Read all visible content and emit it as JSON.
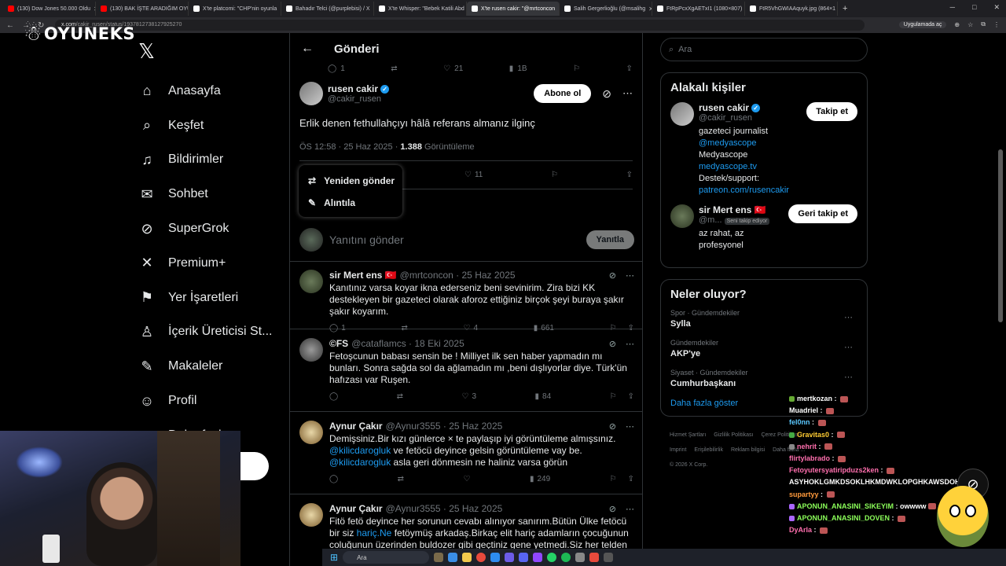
{
  "browser": {
    "tabs": [
      {
        "label": "(130) Dow Jones 50.000 Oldu",
        "color": "#ff0000"
      },
      {
        "label": "(130) BAK İŞTE ARADIĞIM OYUN",
        "color": "#ff0000"
      },
      {
        "label": "X'te platcomi: \"CHP'nin oyunla",
        "color": "#ffffff"
      },
      {
        "label": "Bahadır Telci (@purplebisi) / X",
        "color": "#ffffff"
      },
      {
        "label": "X'te Whisper: \"Bebek Katili Abd",
        "color": "#ffffff"
      },
      {
        "label": "X'te rusen cakir: \"@mrtconcon",
        "color": "#ffffff"
      },
      {
        "label": "Salih Gergerlioğlu (@msalihg",
        "color": "#ffffff"
      },
      {
        "label": "FtRpPcxXgAETxI1 (1080×807)",
        "color": "#ffffff"
      },
      {
        "label": "FtR5VhGWIAAquyk.jpg (864×1",
        "color": "#ffffff"
      }
    ],
    "active_tab": 5,
    "url_host": "x.com",
    "url_path": "/cakir_rusen/status/1937812738127925270",
    "app_button": "Uygulamada aç"
  },
  "overlay": {
    "logo": "OYUNEKS"
  },
  "sidebar": {
    "items": [
      {
        "label": "Anasayfa",
        "icon": "⌂"
      },
      {
        "label": "Keşfet",
        "icon": "⌕"
      },
      {
        "label": "Bildirimler",
        "icon": "♫"
      },
      {
        "label": "Sohbet",
        "icon": "✉"
      },
      {
        "label": "SuperGrok",
        "icon": "⊘"
      },
      {
        "label": "Premium+",
        "icon": "✕"
      },
      {
        "label": "Yer İşaretleri",
        "icon": "⚑"
      },
      {
        "label": "İçerik Üreticisi St...",
        "icon": "♙"
      },
      {
        "label": "Makaleler",
        "icon": "✎"
      },
      {
        "label": "Profil",
        "icon": "☺"
      },
      {
        "label": "Daha fazla",
        "icon": "⋯"
      }
    ]
  },
  "main": {
    "title": "Gönderi",
    "top_actions": {
      "replies": "1",
      "likes": "21",
      "views": "1B"
    },
    "post": {
      "name": "rusen cakir",
      "handle": "@cakir_rusen",
      "subscribe": "Abone ol",
      "text": "Erlik denen fethullahçıyı hâlâ referans almanız ilginç",
      "time": "ÖS 12:58 · 25 Haz 2025 · ",
      "views": "1.388",
      "views_label": " Görüntüleme",
      "likes": "11"
    },
    "popup": {
      "repost": "Yeniden gönder",
      "quote": "Alıntıla"
    },
    "reply_box": {
      "placeholder": "Yanıtını gönder",
      "button": "Yanıtla"
    },
    "replies": [
      {
        "name": "sir Mert ens 🇹🇷",
        "handle": "@mrtconcon · 25 Haz 2025",
        "text": "Kanıtınız varsa koyar ikna ederseniz beni sevinirim. Zira bizi KK destekleyen bir gazeteci olarak aforoz ettiğiniz birçok şeyi buraya şakır şakır koyarım.",
        "replies": "1",
        "likes": "4",
        "views": "661"
      },
      {
        "name": "©FS",
        "handle": "@cataflamcs · 18 Eki 2025",
        "text": "Fetoşcunun babası sensin be ! Milliyet ilk sen haber yapmadın mı bunları. Sonra sağda sol da ağlamadın mı ,beni dışlıyorlar diye. Türk'ün hafızası var Ruşen.",
        "replies": "",
        "likes": "3",
        "views": "84"
      },
      {
        "name": "Aynur Çakır",
        "handle": "@Aynur3555 · 25 Haz 2025",
        "text_pre": "Demişsiniz.Bir kızı günlerce × te paylaşıp iyi görüntüleme almışsınız.",
        "mention1": "@kilicdarogluk",
        "text_mid": " ve fetöcü  deyince gelsin görüntüleme vay be.",
        "mention2": "@kilicdarogluk",
        "text_post": " asla geri dönmesin ne haliniz varsa görün",
        "replies": "",
        "likes": "",
        "views": "249"
      },
      {
        "name": "Aynur Çakır",
        "handle": "@Aynur3555 · 25 Haz 2025",
        "text_pre": "Fitö fetö deyince her sorunun cevabı alınıyor sanırım.Bütün Ülke fetöcü bir siz ",
        "mention1": "hariç.Ne",
        "text_post": " fetöymüş arkadaş.Birkaç elit hariç adamların çocuğunun coluğunun üzerinden buldozer gibi geçtiniz gene yetmedi.Siz her telden"
      }
    ]
  },
  "right": {
    "search_placeholder": "Ara",
    "related_title": "Alakalı kişiler",
    "people": [
      {
        "name": "rusen cakir",
        "handle": "@cakir_rusen",
        "button": "Takip et",
        "bio_line1_pre": "gazeteci journalist ",
        "bio_line1_link": "@medyascope",
        "bio_line2_pre": "Medyascope ",
        "bio_line2_link": "medyascope.tv",
        "bio_line3": "Destek/support:",
        "bio_line4_link": "patreon.com/rusencakir"
      },
      {
        "name": "sir Mert ens 🇹🇷",
        "handle": "@m...",
        "follows_you": "Seni takip ediyor",
        "button": "Geri takip et",
        "bio": "az rahat, az profesyonel"
      }
    ],
    "trends_title": "Neler oluyor?",
    "trends": [
      {
        "category": "Spor · Gündemdekiler",
        "title": "Sylla"
      },
      {
        "category": "Gündemdekiler",
        "title": "AKP'ye"
      },
      {
        "category": "Siyaset · Gündemdekiler",
        "title": "Cumhurbaşkanı"
      }
    ],
    "show_more": "Daha fazla göster",
    "footer": [
      "Hizmet Şartları",
      "Gizlilik Politikası",
      "Çerez Politikası",
      "Imprint",
      "Erişilebilirlik",
      "Reklam bilgisi",
      "Daha fazla ...",
      "© 2026 X Corp."
    ]
  },
  "chat": [
    {
      "user": "mertkozan",
      "msg": "",
      "color": "#ffffff",
      "badge": "#6a3"
    },
    {
      "user": "Muadriel",
      "msg": "",
      "color": "#ffffff",
      "badge": ""
    },
    {
      "user": "fel0nn",
      "msg": "",
      "color": "#5bc8ff",
      "badge": ""
    },
    {
      "user": "Gravitas0",
      "msg": "",
      "color": "#ffcc33",
      "badge": "#4a4"
    },
    {
      "user": "nehrit",
      "msg": "",
      "color": "#ff6fae",
      "badge": "#888"
    },
    {
      "user": "flirtylabrado",
      "msg": "",
      "color": "#ff6fae",
      "badge": ""
    },
    {
      "user": "Fetoyutersyatiripduzs2ken",
      "msg": "",
      "color": "#ff6fae",
      "badge": ""
    },
    {
      "user": "",
      "msg": "ASYHOKLGMKDSOKLHKMDWKLOPGHKAWSDOHAK",
      "color": "#ffffff",
      "badge": ""
    },
    {
      "user": "supartyy",
      "msg": "",
      "color": "#ff9a3c",
      "badge": ""
    },
    {
      "user": "APONUN_ANASINI_SIKEYIM",
      "msg": "owwww",
      "color": "#8cff5a",
      "badge": "#a6f"
    },
    {
      "user": "APONUN_ANASINI_DOVEN",
      "msg": "",
      "color": "#8cff5a",
      "badge": "#a6f"
    },
    {
      "user": "DyArla",
      "msg": "",
      "color": "#ff6fae",
      "badge": ""
    }
  ],
  "taskbar": {
    "search": "Ara"
  }
}
